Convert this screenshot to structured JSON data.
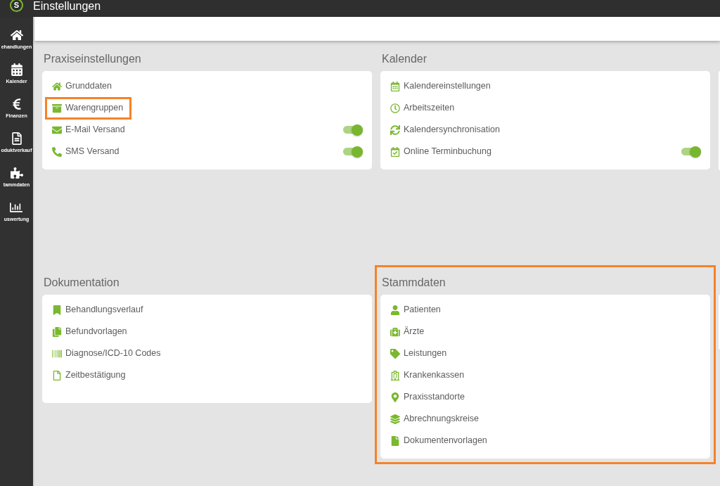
{
  "top_bar": {
    "logo": {
      "letter": "S"
    },
    "title": "Einstellungen"
  },
  "sidebar": {
    "items": [
      {
        "label": "ehandlungen"
      },
      {
        "label": "Kalender"
      },
      {
        "label": "Finanzen"
      },
      {
        "label": "oduktverkauf"
      },
      {
        "label": "tammdaten"
      },
      {
        "label": "uswertung"
      }
    ]
  },
  "sections": [
    {
      "title": "Praxiseinstellungen",
      "highlighted": false,
      "items": [
        {
          "kind": "link",
          "label": "Grunddaten",
          "highlighted": false
        },
        {
          "kind": "link",
          "label": "Warengruppen",
          "highlighted": true
        },
        {
          "kind": "toggle",
          "label": "E-Mail Versand",
          "highlighted": false,
          "on": true
        },
        {
          "kind": "toggle",
          "label": "SMS Versand",
          "highlighted": false,
          "on": true
        }
      ]
    },
    {
      "title": "Kalender",
      "highlighted": false,
      "items": [
        {
          "kind": "link",
          "label": "Kalendereinstellungen",
          "highlighted": false
        },
        {
          "kind": "link",
          "label": "Arbeitszeiten",
          "highlighted": false
        },
        {
          "kind": "link",
          "label": "Kalendersynchronisation",
          "highlighted": false
        },
        {
          "kind": "toggle",
          "label": "Online Terminbuchung",
          "highlighted": false,
          "on": true
        }
      ]
    },
    {
      "title": "Dokumentation",
      "highlighted": false,
      "items": [
        {
          "kind": "link",
          "label": "Behandlungsverlauf",
          "highlighted": false
        },
        {
          "kind": "link",
          "label": "Befundvorlagen",
          "highlighted": false
        },
        {
          "kind": "link",
          "label": "Diagnose/ICD-10 Codes",
          "highlighted": false
        },
        {
          "kind": "link",
          "label": "Zeitbestätigung",
          "highlighted": false
        }
      ]
    },
    {
      "title": "Stammdaten",
      "highlighted": true,
      "items": [
        {
          "kind": "link",
          "label": "Patienten",
          "highlighted": false
        },
        {
          "kind": "link",
          "label": "Ärzte",
          "highlighted": false
        },
        {
          "kind": "link",
          "label": "Leistungen",
          "highlighted": false
        },
        {
          "kind": "link",
          "label": "Krankenkassen",
          "highlighted": false
        },
        {
          "kind": "link",
          "label": "Praxisstandorte",
          "highlighted": false
        },
        {
          "kind": "link",
          "label": "Abrechnungskreise",
          "highlighted": false
        },
        {
          "kind": "link",
          "label": "Dokumentenvorlagen",
          "highlighted": false
        }
      ]
    }
  ]
}
